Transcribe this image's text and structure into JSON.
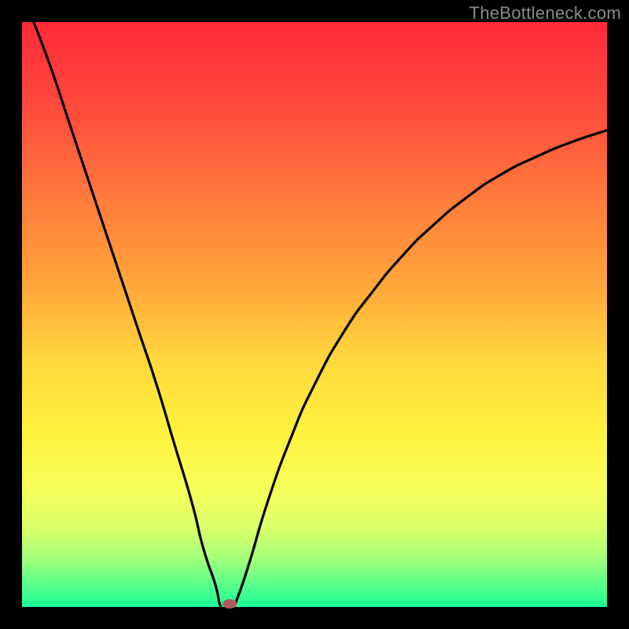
{
  "watermark": "TheBottleneck.com",
  "chart_data": {
    "type": "line",
    "title": "",
    "xlabel": "",
    "ylabel": "",
    "xlim": [
      0,
      1
    ],
    "ylim": [
      0,
      1
    ],
    "series": [
      {
        "name": "bottleneck-curve",
        "x": [
          0.02,
          0.05,
          0.08,
          0.11,
          0.14,
          0.17,
          0.2,
          0.23,
          0.26,
          0.29,
          0.31,
          0.33,
          0.34,
          0.35,
          0.36,
          0.37,
          0.39,
          0.42,
          0.46,
          0.5,
          0.55,
          0.6,
          0.65,
          0.7,
          0.76,
          0.82,
          0.88,
          0.94,
          1.0
        ],
        "y": [
          1.0,
          0.92,
          0.83,
          0.74,
          0.65,
          0.56,
          0.47,
          0.38,
          0.28,
          0.18,
          0.1,
          0.04,
          0.0,
          0.0,
          0.0,
          0.02,
          0.08,
          0.18,
          0.29,
          0.38,
          0.47,
          0.54,
          0.6,
          0.65,
          0.7,
          0.74,
          0.77,
          0.795,
          0.815
        ]
      }
    ],
    "marker": {
      "x": 0.355,
      "y": 0.0
    },
    "colors": {
      "top": "#ff2a3a",
      "mid": "#ffd83c",
      "bottom": "#1bff98",
      "curve": "#000000",
      "marker": "#b15a5a"
    }
  }
}
